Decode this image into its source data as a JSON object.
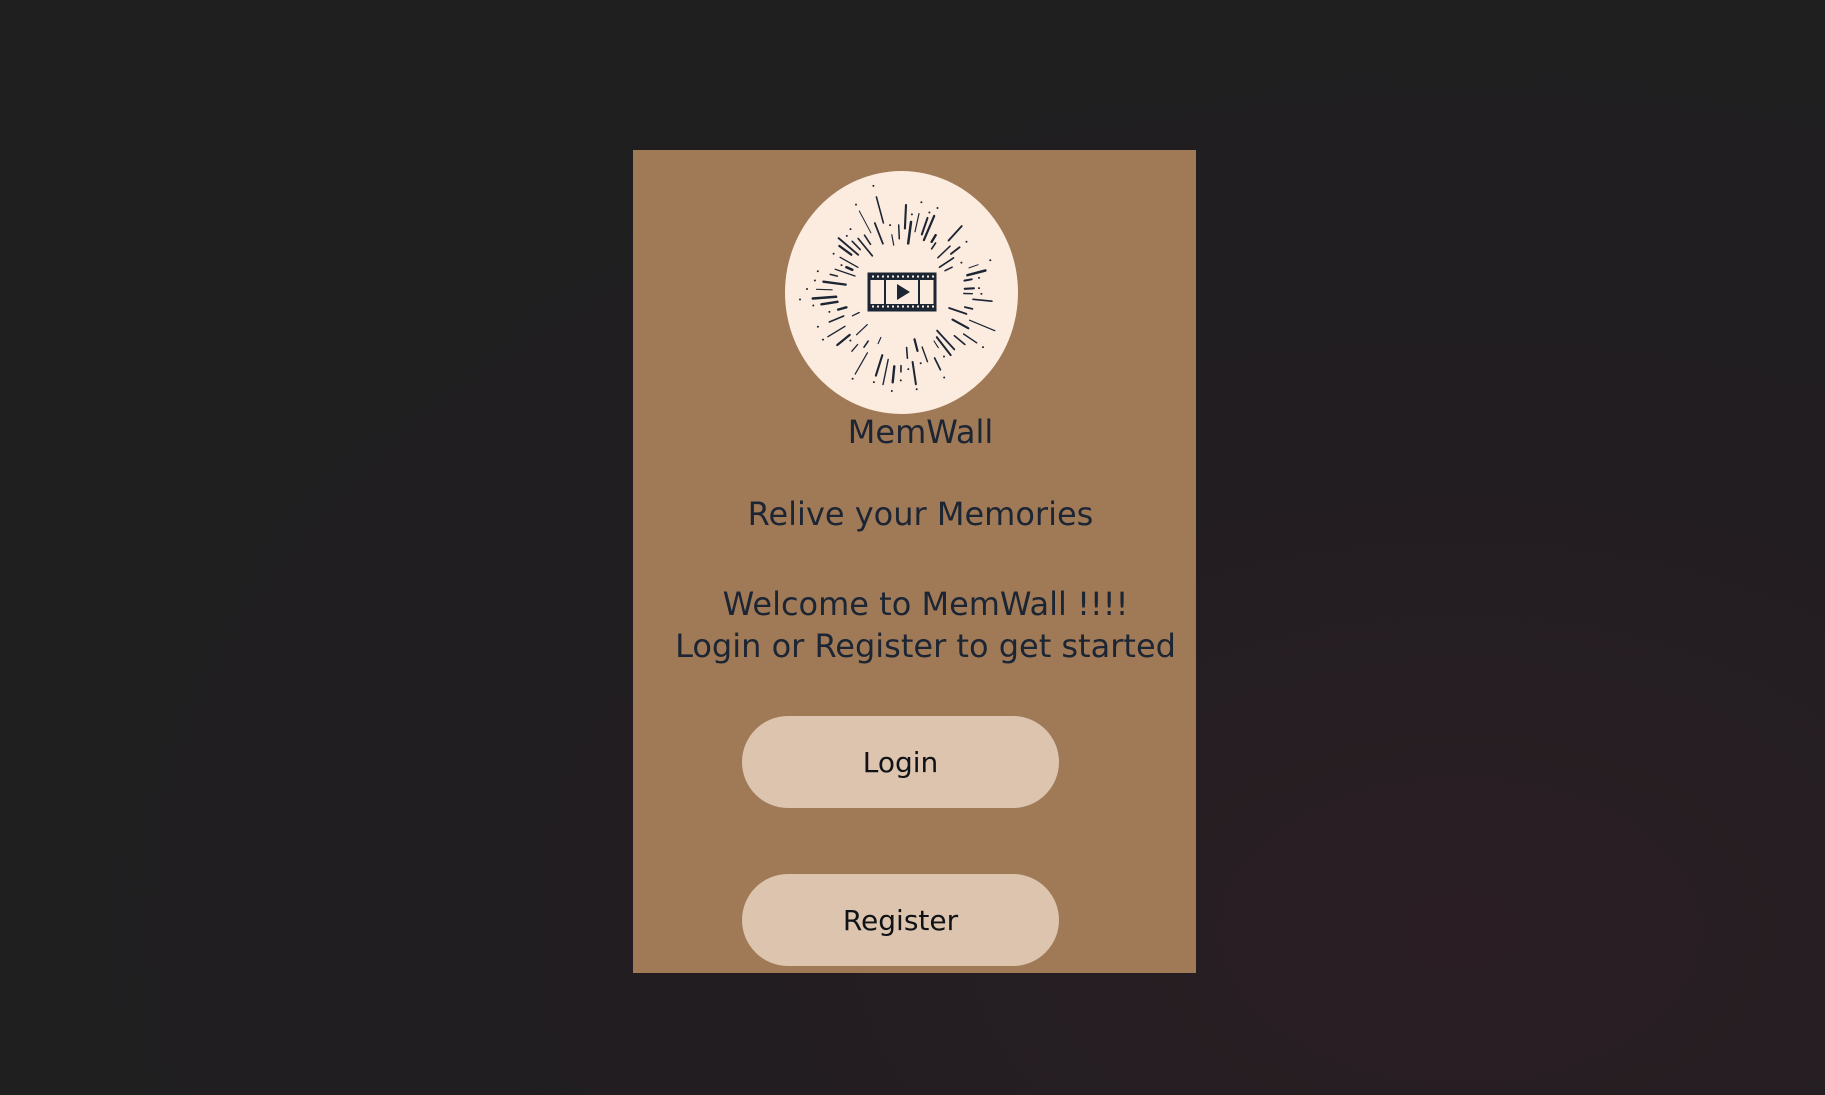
{
  "app": {
    "name": "MemWall",
    "tagline": "Relive your Memories",
    "welcome_line1": "Welcome to MemWall !!!!",
    "welcome_line2": "Login or Register to get started"
  },
  "logo": {
    "icon": "film-play-icon"
  },
  "actions": {
    "login_label": "Login",
    "register_label": "Register"
  },
  "colors": {
    "page_background": "#1f1f20",
    "card_background": "#a07a57",
    "logo_background": "#fcebdf",
    "button_background": "#dcc4ae",
    "text": "#1c2533"
  }
}
